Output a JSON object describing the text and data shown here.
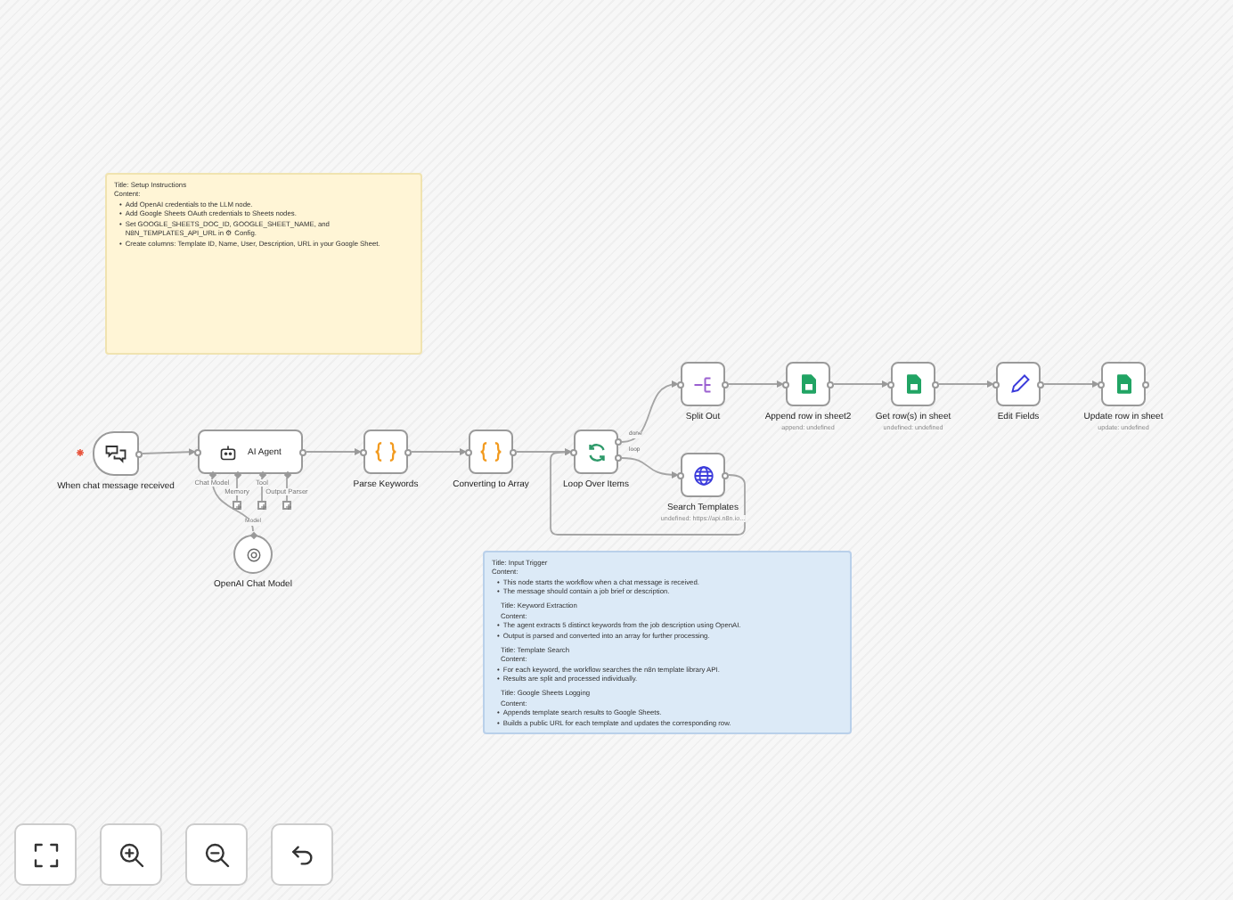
{
  "sticky_notes": [
    {
      "kind": "yellow",
      "bullet": "•",
      "lines": [
        {
          "kind": "plain",
          "text": "Title: Setup Instructions"
        },
        {
          "kind": "plain",
          "text": "Content:"
        },
        {
          "kind": "bullet",
          "text": "Add OpenAI credentials to the LLM node."
        },
        {
          "kind": "bullet",
          "text": "Add Google Sheets OAuth credentials to Sheets nodes."
        },
        {
          "kind": "bullet",
          "text": "Set GOOGLE_SHEETS_DOC_ID, GOOGLE_SHEET_NAME, and N8N_TEMPLATES_API_URL in ⚙ Config."
        },
        {
          "kind": "bullet",
          "text": "Create columns: Template ID, Name, User, Description, URL in your Google Sheet."
        }
      ]
    },
    {
      "kind": "blue",
      "bullet": "•",
      "lines": [
        {
          "kind": "plain",
          "text": "Title: Input Trigger"
        },
        {
          "kind": "plain",
          "text": "Content:"
        },
        {
          "kind": "bullet",
          "text": "This node starts the workflow when a chat message is received."
        },
        {
          "kind": "bullet",
          "text": "The message should contain a job brief or description."
        },
        {
          "kind": "indent",
          "text": "Title: Keyword Extraction"
        },
        {
          "kind": "indent",
          "text": "Content:"
        },
        {
          "kind": "bullet",
          "text": "The agent extracts 5 distinct keywords from the job description using OpenAI."
        },
        {
          "kind": "bullet",
          "text": "Output is parsed and converted into an array for further processing."
        },
        {
          "kind": "indent",
          "text": "Title: Template Search"
        },
        {
          "kind": "indent",
          "text": "Content:"
        },
        {
          "kind": "bullet",
          "text": "For each keyword, the workflow searches the n8n template library API."
        },
        {
          "kind": "bullet",
          "text": "Results are split and processed individually."
        },
        {
          "kind": "indent",
          "text": "Title: Google Sheets Logging"
        },
        {
          "kind": "indent",
          "text": "Content:"
        },
        {
          "kind": "bullet",
          "text": "Appends template search results to Google Sheets."
        },
        {
          "kind": "bullet",
          "text": "Builds a public URL for each template and updates the corresponding row."
        }
      ]
    }
  ],
  "nodes": [
    {
      "kind": "chat",
      "label": "When chat message received"
    },
    {
      "kind": "agent",
      "label": "AI Agent",
      "ports": [
        "Chat Model",
        "Memory",
        "Tool",
        "Output Parser"
      ]
    },
    {
      "kind": "code",
      "label": "Parse Keywords"
    },
    {
      "kind": "code",
      "label": "Converting to Array"
    },
    {
      "kind": "loop",
      "label": "Loop Over Items",
      "outputs": [
        "done",
        "loop"
      ]
    },
    {
      "kind": "split",
      "label": "Split Out"
    },
    {
      "kind": "http",
      "label": "Search Templates",
      "subtitle": "undefined: https://api.n8n.io..."
    },
    {
      "kind": "sheets",
      "label": "Append row in sheet2",
      "subtitle": "append: undefined"
    },
    {
      "kind": "sheets",
      "label": "Get row(s) in sheet",
      "subtitle": "undefined: undefined"
    },
    {
      "kind": "set",
      "label": "Edit Fields"
    },
    {
      "kind": "sheets",
      "label": "Update row in sheet",
      "subtitle": "update: undefined"
    },
    {
      "kind": "model",
      "label": "OpenAI Chat Model",
      "port": "Model"
    }
  ],
  "controls": [
    {
      "kind": "fit"
    },
    {
      "kind": "zoom_in"
    },
    {
      "kind": "zoom_out"
    },
    {
      "kind": "undo"
    }
  ]
}
